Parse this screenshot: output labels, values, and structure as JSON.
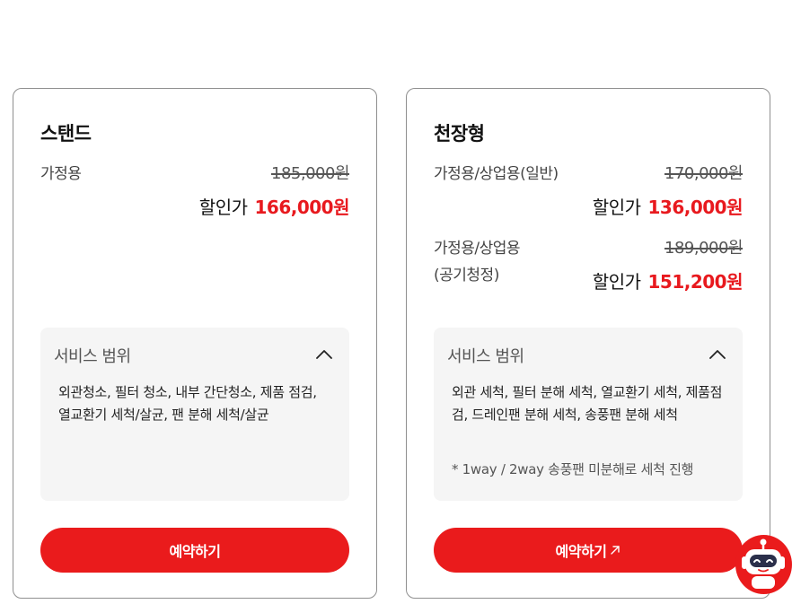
{
  "cards": [
    {
      "title": "스탠드",
      "prices": [
        {
          "label": "가정용",
          "original": "185,000원",
          "sale_label": "할인가",
          "sale_price": "166,000원"
        }
      ],
      "service": {
        "title": "서비스 범위",
        "description": "외관청소, 필터 청소, 내부 간단청소, 제품 점검, 열교환기 세척/살균, 팬 분해 세척/살균",
        "note": ""
      },
      "button_label": "예약하기"
    },
    {
      "title": "천장형",
      "prices": [
        {
          "label": "가정용/상업용(일반)",
          "original": "170,000원",
          "sale_label": "할인가",
          "sale_price": "136,000원"
        },
        {
          "label": "가정용/상업용",
          "label_line2": "(공기청정)",
          "original": "189,000원",
          "sale_label": "할인가",
          "sale_price": "151,200원"
        }
      ],
      "service": {
        "title": "서비스 범위",
        "description": "외관 세척, 필터 분해 세척, 열교환기 세척, 제품점검, 드레인팬 분해 세척, 송풍팬 분해 세척",
        "note": "* 1way / 2way 송풍팬 미분해로 세척 진행"
      },
      "button_label": "예약하기"
    }
  ],
  "colors": {
    "accent": "#ea1b1c",
    "sale_price": "#e8191e",
    "service_bg": "#f5f5f5",
    "border": "#8f8f8f"
  },
  "icons": {
    "collapse": "chevron-up-icon",
    "external": "arrow-up-right-icon",
    "chatbot": "robot-icon"
  }
}
